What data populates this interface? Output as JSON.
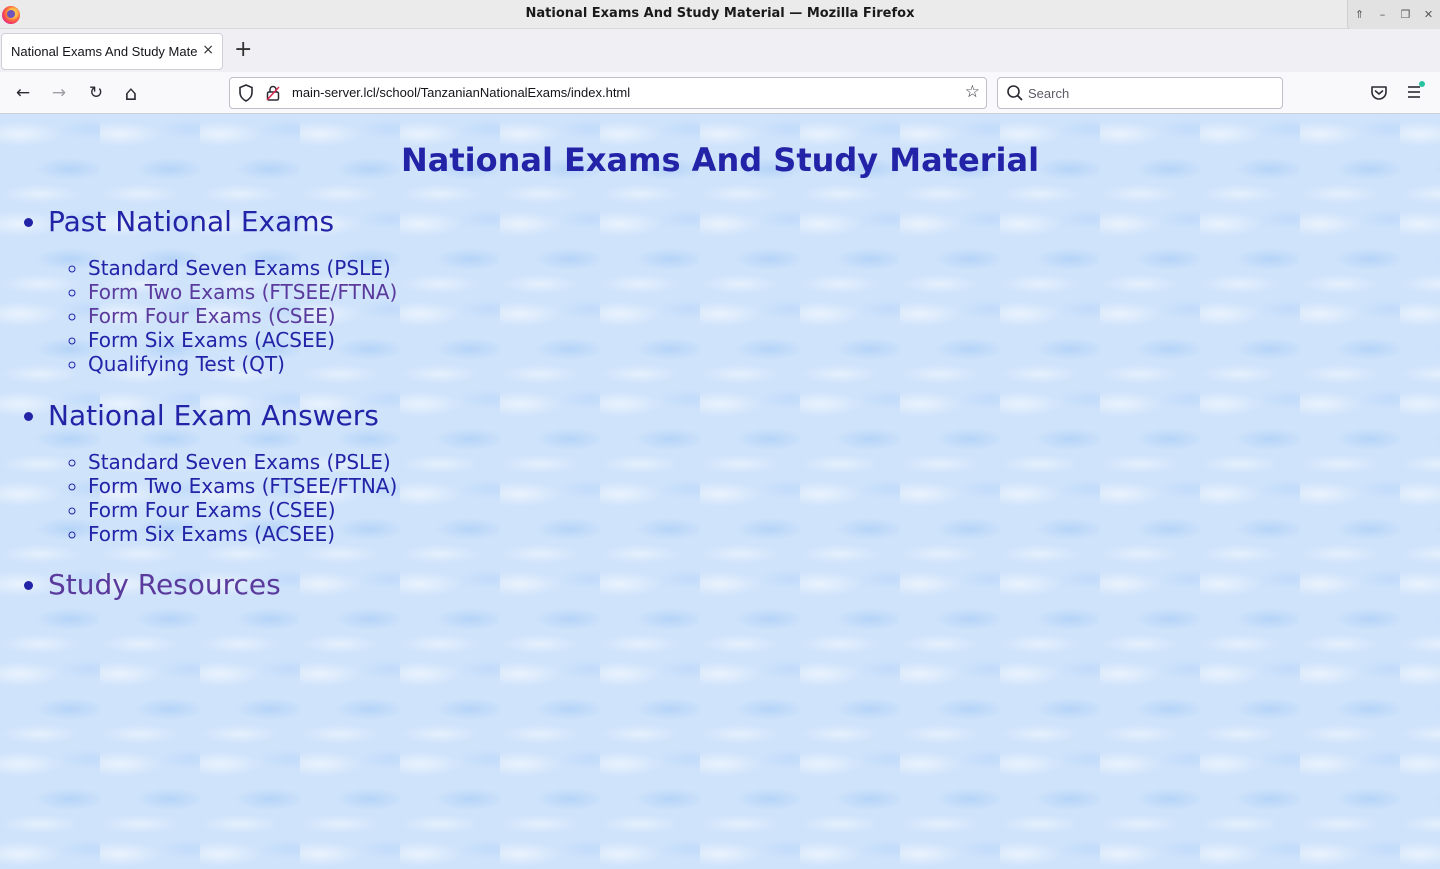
{
  "window": {
    "title": "National Exams And Study Material — Mozilla Firefox",
    "controls": [
      "⇑",
      "–",
      "❐",
      "✕"
    ]
  },
  "tab": {
    "label": "National Exams And Study Material",
    "close": "×",
    "new_tab": "+"
  },
  "nav": {
    "back": "←",
    "forward": "→",
    "reload": "↻",
    "home": "⌂",
    "url": "main-server.lcl/school/TanzanianNationalExams/index.html",
    "bookmark": "☆",
    "search_placeholder": "Search"
  },
  "page": {
    "title": "National Exams And Study Material",
    "sections": [
      {
        "heading": "Past National Exams",
        "visited": false,
        "items": [
          {
            "label": "Standard Seven Exams (PSLE)",
            "visited": false
          },
          {
            "label": "Form Two Exams (FTSEE/FTNA)",
            "visited": true
          },
          {
            "label": "Form Four Exams (CSEE)",
            "visited": true
          },
          {
            "label": "Form Six Exams (ACSEE)",
            "visited": false
          },
          {
            "label": "Qualifying Test (QT)",
            "visited": false
          }
        ]
      },
      {
        "heading": "National Exam Answers",
        "visited": false,
        "items": [
          {
            "label": "Standard Seven Exams (PSLE)",
            "visited": false
          },
          {
            "label": "Form Two Exams (FTSEE/FTNA)",
            "visited": false
          },
          {
            "label": "Form Four Exams (CSEE)",
            "visited": false
          },
          {
            "label": "Form Six Exams (ACSEE)",
            "visited": false
          }
        ]
      },
      {
        "heading": "Study Resources",
        "visited": true,
        "items": []
      }
    ]
  },
  "colors": {
    "link": "#2323a8",
    "visited_link": "#5a3a9c",
    "page_background": "#cfe3fb"
  }
}
